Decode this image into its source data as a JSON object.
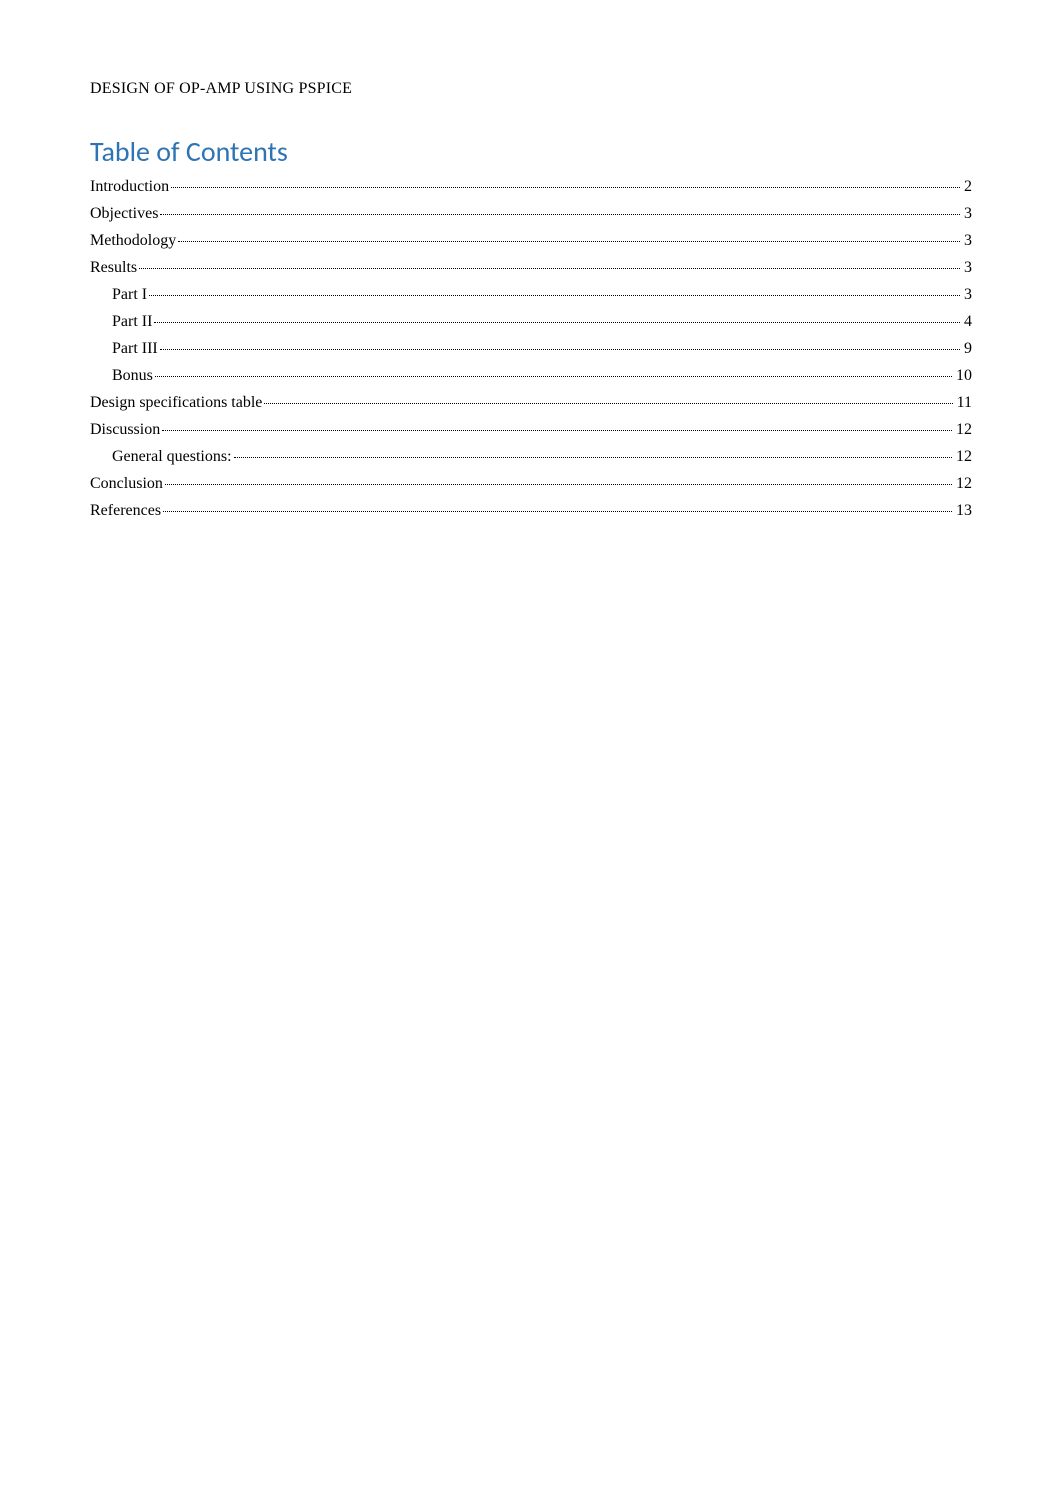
{
  "header": {
    "title": "DESIGN OF OP-AMP USING PSPICE"
  },
  "toc": {
    "heading": "Table of Contents",
    "entries": [
      {
        "label": "Introduction",
        "page": "2",
        "indent": 0
      },
      {
        "label": "Objectives",
        "page": "3",
        "indent": 0
      },
      {
        "label": "Methodology",
        "page": "3",
        "indent": 0
      },
      {
        "label": "Results",
        "page": "3",
        "indent": 0
      },
      {
        "label": "Part I",
        "page": "3",
        "indent": 1
      },
      {
        "label": "Part II",
        "page": "4",
        "indent": 1
      },
      {
        "label": "Part III",
        "page": "9",
        "indent": 1
      },
      {
        "label": "Bonus",
        "page": "10",
        "indent": 1
      },
      {
        "label": "Design specifications table",
        "page": "11",
        "indent": 0
      },
      {
        "label": "Discussion",
        "page": "12",
        "indent": 0
      },
      {
        "label": "General questions:",
        "page": "12",
        "indent": 1
      },
      {
        "label": "Conclusion",
        "page": "12",
        "indent": 0
      },
      {
        "label": "References",
        "page": "13",
        "indent": 0
      }
    ]
  }
}
